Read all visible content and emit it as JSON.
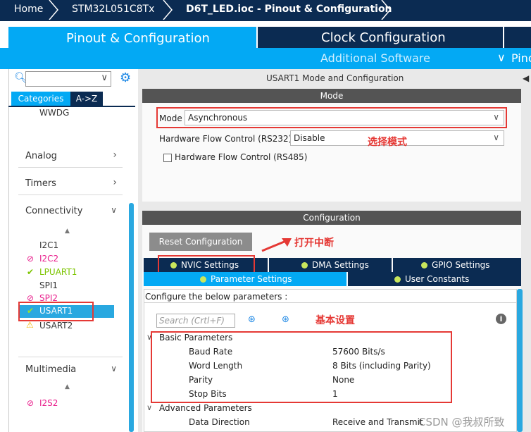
{
  "breadcrumb": {
    "home": "Home",
    "mcu": "STM32L051C8Tx",
    "page": "D6T_LED.ioc - Pinout & Configuration"
  },
  "tabs": {
    "pinout": "Pinout & Configuration",
    "clock": "Clock Configuration",
    "additional": "Additional Software",
    "pinout_view": "Pino"
  },
  "left": {
    "search_placeholder": "",
    "cat_tab_categories": "Categories",
    "cat_tab_az": "A->Z",
    "wwdg": "WWDG",
    "categories": [
      "Analog",
      "Timers",
      "Connectivity"
    ],
    "connectivity_items": [
      {
        "label": "I2C1",
        "status": "none"
      },
      {
        "label": "I2C2",
        "status": "disabled"
      },
      {
        "label": "LPUART1",
        "status": "ok"
      },
      {
        "label": "SPI1",
        "status": "none"
      },
      {
        "label": "SPI2",
        "status": "disabled"
      },
      {
        "label": "USART1",
        "status": "ok"
      },
      {
        "label": "USART2",
        "status": "warning"
      }
    ],
    "multimedia": "Multimedia",
    "i2s2": "I2S2"
  },
  "mode": {
    "panel_title": "USART1 Mode and Configuration",
    "section": "Mode",
    "mode_label": "Mode",
    "mode_value": "Asynchronous",
    "hwflow_label": "Hardware Flow Control (RS232)",
    "hwflow_value": "Disable",
    "rs485_label": "Hardware Flow Control (RS485)",
    "note_mode": "选择模式"
  },
  "config": {
    "section": "Configuration",
    "reset_button": "Reset Configuration",
    "note_nvic": "打开中断",
    "tabs": [
      "NVIC Settings",
      "DMA Settings",
      "GPIO Settings",
      "Parameter Settings",
      "User Constants"
    ],
    "configure_text": "Configure the below parameters :",
    "search_placeholder": "Search (Crtl+F)",
    "note_basic": "基本设置",
    "basic_header": "Basic Parameters",
    "params": [
      {
        "label": "Baud Rate",
        "value": "57600 Bits/s"
      },
      {
        "label": "Word Length",
        "value": "8 Bits (including Parity)"
      },
      {
        "label": "Parity",
        "value": "None"
      },
      {
        "label": "Stop Bits",
        "value": "1"
      }
    ],
    "advanced_header": "Advanced Parameters",
    "data_direction_label": "Data Direction",
    "data_direction_value": "Receive and Transmit"
  },
  "watermark": "CSDN @我叔所致",
  "colors": {
    "brand_blue": "#03a9f4",
    "nav_dark": "#0b2b52",
    "highlight": "#e53935",
    "ok_green": "#7cc400"
  }
}
